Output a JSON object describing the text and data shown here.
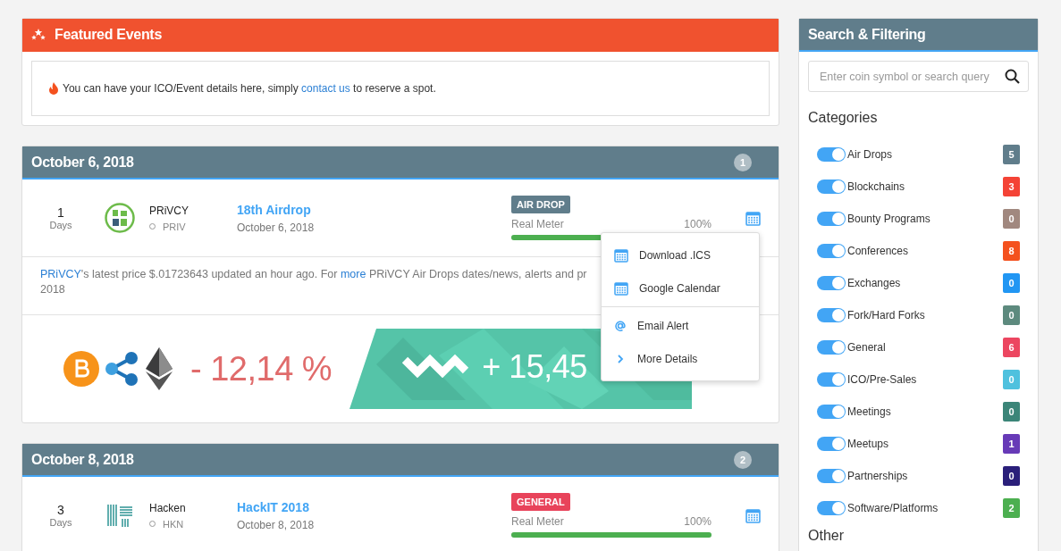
{
  "featured": {
    "title": "Featured Events",
    "message": {
      "before": "You can have your ICO/Event details here, simply ",
      "link": "contact us",
      "after": " to reserve a spot."
    }
  },
  "days": [
    {
      "date": "October 6, 2018",
      "count": "1",
      "events": [
        {
          "days": "1",
          "days_label": "Days",
          "coin": "PRiVCY",
          "symbol": "PRIV",
          "title": "18th Airdrop",
          "date": "October 6, 2018",
          "tag": "AIR DROP",
          "color": "#607d8b",
          "meter_label": "Real Meter",
          "meter_value": "100%",
          "level": 1,
          "description": [
            {
              "text": "PRiVCY",
              "link": true
            },
            {
              "text": "'s latest price $.01723643 updated an hour ago. For ",
              "link": false
            },
            {
              "text": "more",
              "link": true
            },
            {
              "text": " PRiVCY Air Drops dates/news, alerts and pr",
              "link": false
            }
          ],
          "description_line_2": "2018",
          "banner": {
            "loss": "- 12,14 %",
            "gain": "+ 15,45"
          }
        }
      ]
    },
    {
      "date": "October 8, 2018",
      "count": "2",
      "events": [
        {
          "days": "3",
          "days_label": "Days",
          "coin": "Hacken",
          "symbol": "HKN",
          "title": "HackIT 2018",
          "date": "October 8, 2018",
          "tag": "GENERAL",
          "color": "#e8435a",
          "meter_label": "Real Meter",
          "meter_value": "100%",
          "level": 1
        }
      ]
    }
  ],
  "menu": {
    "groups": [
      [
        {
          "label": "Download .ICS",
          "kind": "calendar"
        },
        {
          "label": "Google Calendar",
          "kind": "calendar"
        }
      ],
      [
        {
          "label": "Email Alert",
          "kind": "email"
        },
        {
          "label": "More Details",
          "kind": "chevron"
        }
      ]
    ]
  },
  "sidebar": {
    "title": "Search & Filtering",
    "search": {
      "placeholder": "Enter coin symbol or search query"
    },
    "categories_heading": "Categories",
    "categories": [
      {
        "label": "Air Drops",
        "on": true,
        "count": "5",
        "color": "#607d8b"
      },
      {
        "label": "Blockchains",
        "on": true,
        "count": "3",
        "color": "#f44336"
      },
      {
        "label": "Bounty Programs",
        "on": true,
        "count": "0",
        "color": "#a1887f"
      },
      {
        "label": "Conferences",
        "on": true,
        "count": "8",
        "color": "#f4511e"
      },
      {
        "label": "Exchanges",
        "on": true,
        "count": "0",
        "color": "#2196f3"
      },
      {
        "label": "Fork/Hard Forks",
        "on": true,
        "count": "0",
        "color": "#5d8a7e"
      },
      {
        "label": "General",
        "on": true,
        "count": "6",
        "color": "#ec4660"
      },
      {
        "label": "ICO/Pre-Sales",
        "on": true,
        "count": "0",
        "color": "#4fc1de"
      },
      {
        "label": "Meetings",
        "on": true,
        "count": "0",
        "color": "#3b8578"
      },
      {
        "label": "Meetups",
        "on": true,
        "count": "1",
        "color": "#673ab7"
      },
      {
        "label": "Partnerships",
        "on": true,
        "count": "0",
        "color": "#2a1f7a"
      },
      {
        "label": "Software/Platforms",
        "on": true,
        "count": "2",
        "color": "#4caf50"
      }
    ],
    "other_heading": "Other"
  }
}
